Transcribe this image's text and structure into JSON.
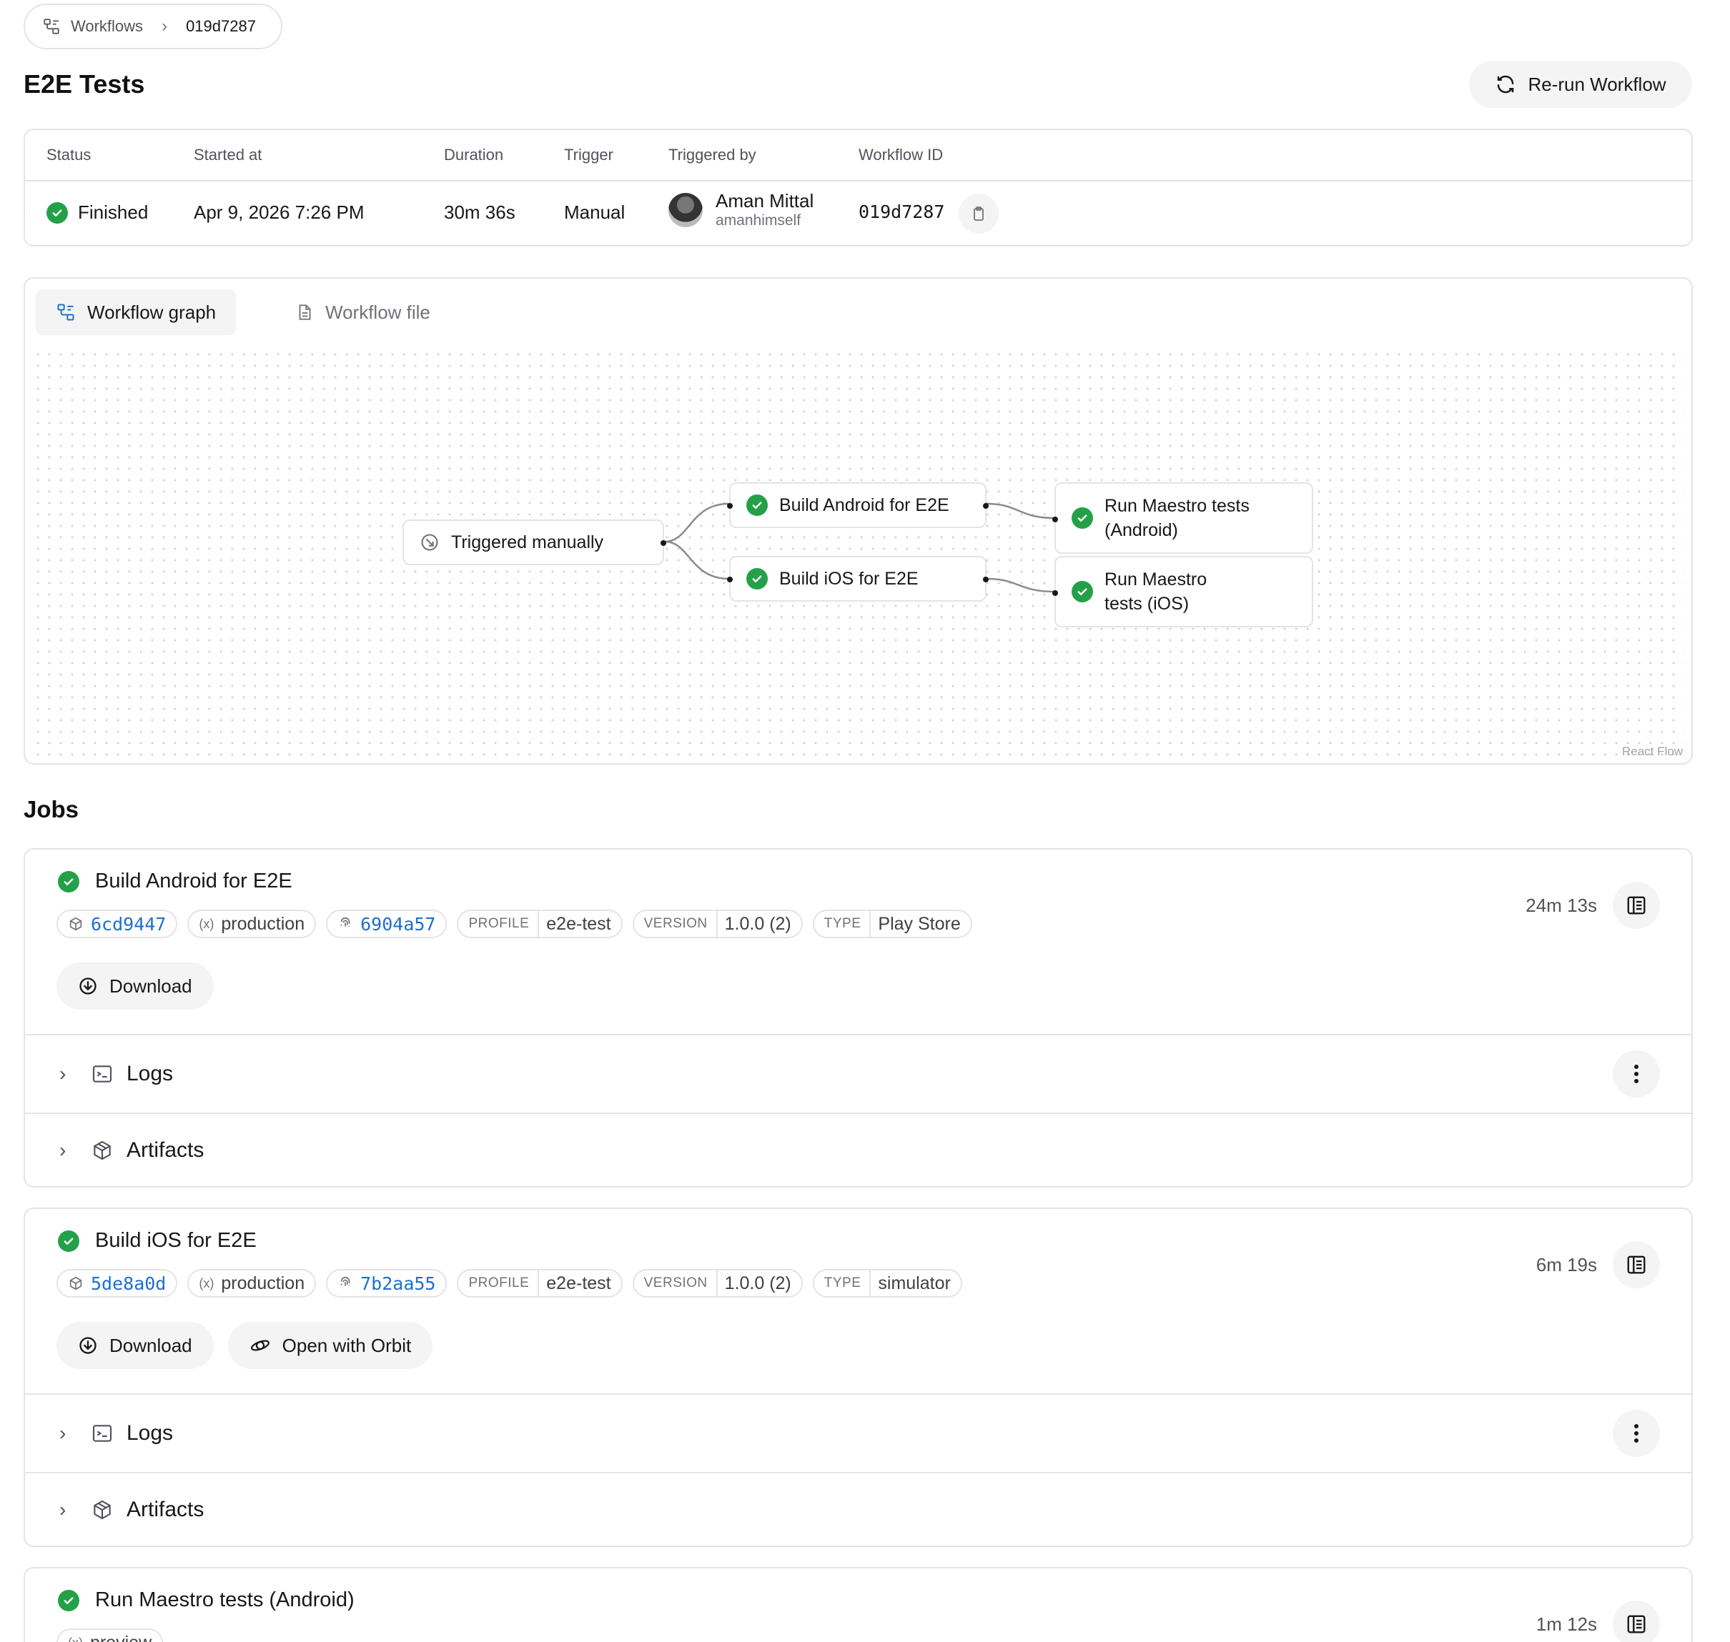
{
  "breadcrumb": {
    "root": "Workflows",
    "current": "019d7287"
  },
  "page": {
    "title": "E2E Tests",
    "rerun_label": "Re-run Workflow"
  },
  "summary": {
    "headers": {
      "status": "Status",
      "started": "Started at",
      "duration": "Duration",
      "trigger": "Trigger",
      "triggered_by": "Triggered by",
      "workflow_id": "Workflow ID"
    },
    "status": "Finished",
    "started": "Apr 9, 2026 7:26 PM",
    "duration": "30m 36s",
    "trigger": "Manual",
    "user_name": "Aman Mittal",
    "user_handle": "amanhimself",
    "workflow_id": "019d7287"
  },
  "graph": {
    "tabs": {
      "graph": "Workflow graph",
      "file": "Workflow file"
    },
    "nodes": {
      "trigger": "Triggered manually",
      "build_android": "Build Android for E2E",
      "build_ios": "Build iOS for E2E",
      "maestro_android_1": "Run Maestro tests",
      "maestro_android_2": "(Android)",
      "maestro_ios_1": "Run Maestro",
      "maestro_ios_2": "tests (iOS)"
    },
    "attribution": "React Flow"
  },
  "jobs": {
    "title": "Jobs",
    "items": [
      {
        "title": "Build Android for E2E",
        "commit": "6cd9447",
        "env": "production",
        "fingerprint": "6904a57",
        "profile_label": "PROFILE",
        "profile": "e2e-test",
        "version_label": "VERSION",
        "version": "1.0.0 (2)",
        "type_label": "TYPE",
        "type": "Play Store",
        "download": "Download",
        "duration": "24m 13s",
        "logs": "Logs",
        "artifacts": "Artifacts"
      },
      {
        "title": "Build iOS for E2E",
        "commit": "5de8a0d",
        "env": "production",
        "fingerprint": "7b2aa55",
        "profile_label": "PROFILE",
        "profile": "e2e-test",
        "version_label": "VERSION",
        "version": "1.0.0 (2)",
        "type_label": "TYPE",
        "type": "simulator",
        "download": "Download",
        "orbit": "Open with Orbit",
        "duration": "6m 19s",
        "logs": "Logs",
        "artifacts": "Artifacts"
      },
      {
        "title": "Run Maestro tests (Android)",
        "env": "preview",
        "duration": "1m 12s"
      }
    ]
  },
  "colors": {
    "success": "#24a148",
    "link": "#1d6fd1",
    "border": "#e4e4e7",
    "button_bg": "#f4f4f5"
  }
}
